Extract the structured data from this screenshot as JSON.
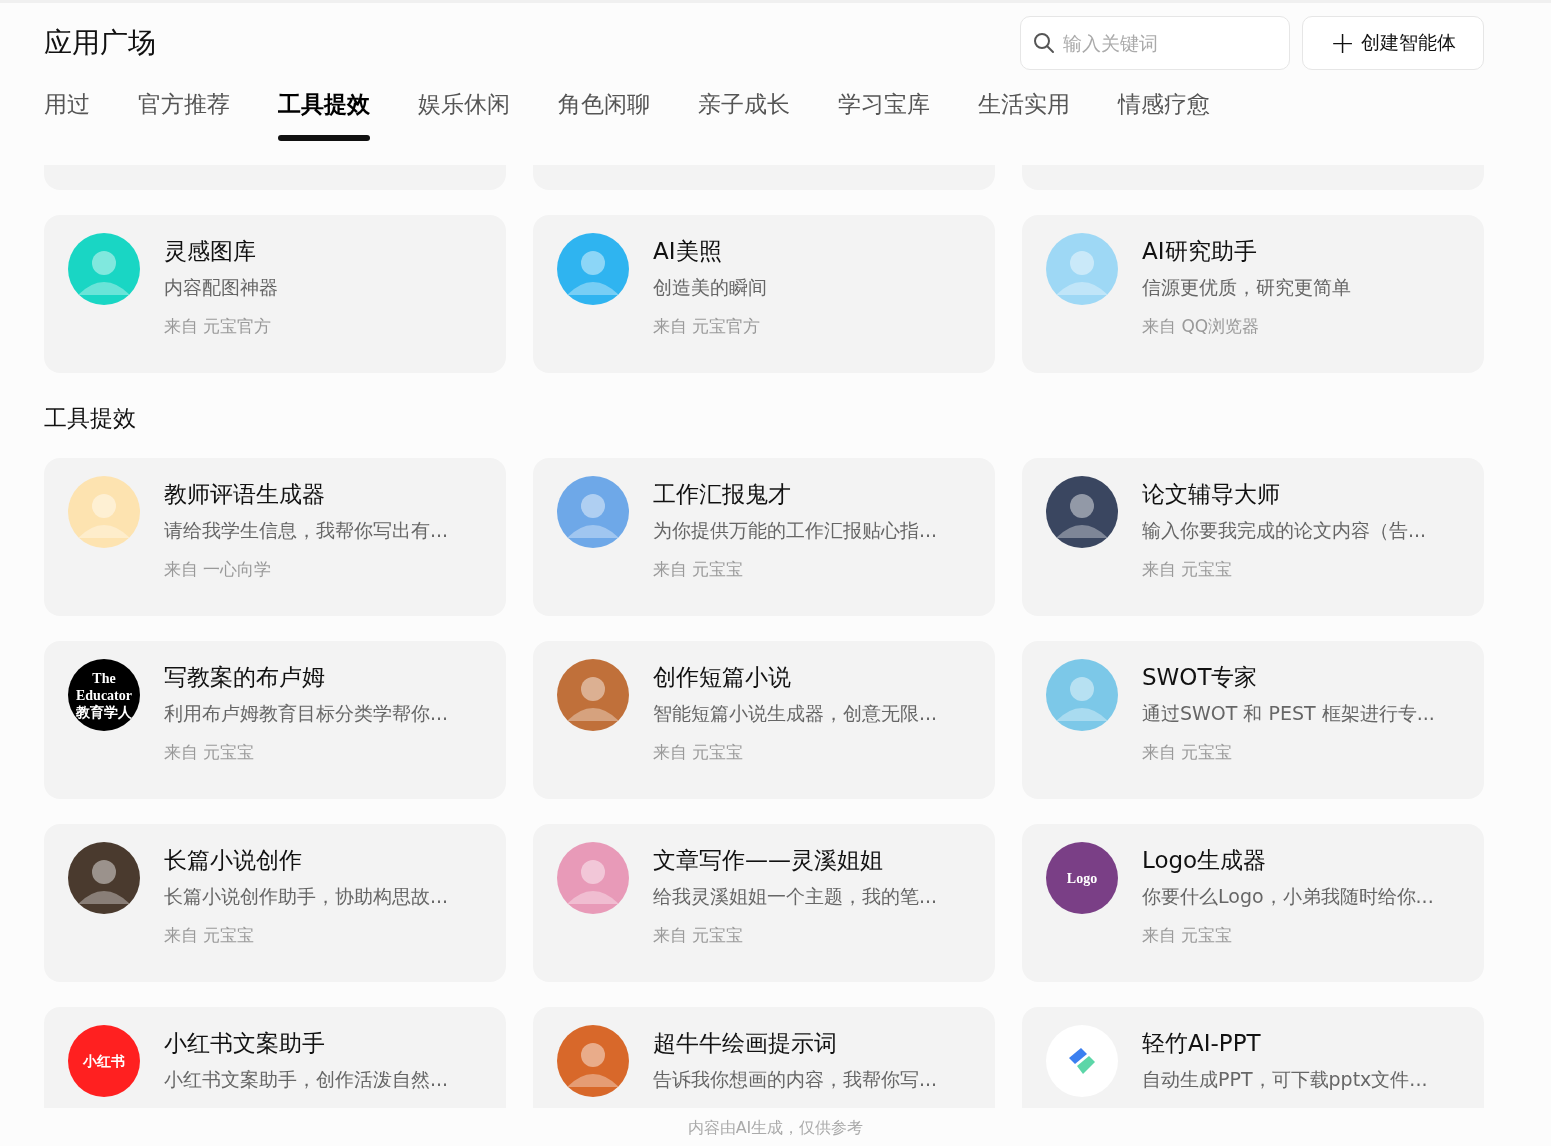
{
  "header": {
    "title": "应用广场",
    "search": {
      "placeholder": "输入关键词"
    },
    "create_button": {
      "label": "创建智能体",
      "icon": "+"
    }
  },
  "tabs": [
    {
      "label": "用过",
      "selected": false
    },
    {
      "label": "官方推荐",
      "selected": false
    },
    {
      "label": "工具提效",
      "selected": true
    },
    {
      "label": "娱乐休闲",
      "selected": false
    },
    {
      "label": "角色闲聊",
      "selected": false
    },
    {
      "label": "亲子成长",
      "selected": false
    },
    {
      "label": "学习宝库",
      "selected": false
    },
    {
      "label": "生活实用",
      "selected": false
    },
    {
      "label": "情感疗愈",
      "selected": false
    }
  ],
  "sections": [
    {
      "cards": [
        {
          "title": "灵感图库",
          "description": "内容配图神器",
          "source": "来自 元宝官方",
          "avatar": {
            "kind": "picture",
            "color": "#19d6c4"
          }
        },
        {
          "title": "AI美照",
          "description": "创造美的瞬间",
          "source": "来自 元宝官方",
          "avatar": {
            "kind": "picture",
            "color": "#2fb4f0"
          }
        },
        {
          "title": "AI研究助手",
          "description": "信源更优质，研究更简单",
          "source": "来自 QQ浏览器",
          "avatar": {
            "kind": "picture",
            "color": "#9ed8f5"
          }
        }
      ]
    },
    {
      "title": "工具提效",
      "cards": [
        {
          "title": "教师评语生成器",
          "description": "请给我学生信息，我帮你写出有...",
          "source": "来自 一心向学",
          "avatar": {
            "kind": "picture",
            "color": "#fde3b0"
          }
        },
        {
          "title": "工作汇报鬼才",
          "description": "为你提供万能的工作汇报贴心指...",
          "source": "来自 元宝宝",
          "avatar": {
            "kind": "picture",
            "color": "#6ea8e8"
          }
        },
        {
          "title": "论文辅导大师",
          "description": "输入你要我完成的论文内容（告...",
          "source": "来自 元宝宝",
          "avatar": {
            "kind": "picture",
            "color": "#3a4660"
          }
        },
        {
          "title": "写教案的布卢姆",
          "description": "利用布卢姆教育目标分类学帮你...",
          "source": "来自 元宝宝",
          "avatar": {
            "kind": "logo",
            "color": "#000000",
            "lines": [
              "The",
              "Educator",
              "教育学人"
            ]
          }
        },
        {
          "title": "创作短篇小说",
          "description": "智能短篇小说生成器，创意无限...",
          "source": "来自 元宝宝",
          "avatar": {
            "kind": "picture",
            "color": "#c0703a"
          }
        },
        {
          "title": "SWOT专家",
          "description": "通过SWOT 和 PEST 框架进行专...",
          "source": "来自 元宝宝",
          "avatar": {
            "kind": "picture",
            "color": "#7cc8e8"
          }
        },
        {
          "title": "长篇小说创作",
          "description": "长篇小说创作助手，协助构思故...",
          "source": "来自 元宝宝",
          "avatar": {
            "kind": "picture",
            "color": "#4a3a2e"
          }
        },
        {
          "title": "文章写作——灵溪姐姐",
          "description": "给我灵溪姐姐一个主题，我的笔...",
          "source": "来自 元宝宝",
          "avatar": {
            "kind": "picture",
            "color": "#e89ab8"
          }
        },
        {
          "title": "Logo生成器",
          "description": "你要什么Logo，小弟我随时给你...",
          "source": "来自 元宝宝",
          "avatar": {
            "kind": "logo",
            "color": "#7a3f86",
            "lines": [
              "Logo"
            ]
          }
        },
        {
          "title": "小红书文案助手",
          "description": "小红书文案助手，创作活泼自然...",
          "avatar": {
            "kind": "logo",
            "color": "#ff2020",
            "lines": [
              "小红书"
            ]
          }
        },
        {
          "title": "超牛牛绘画提示词",
          "description": "告诉我你想画的内容，我帮你写...",
          "avatar": {
            "kind": "picture",
            "color": "#d8682a"
          }
        },
        {
          "title": "轻竹AI-PPT",
          "description": "自动生成PPT，可下载pptx文件...",
          "avatar": {
            "kind": "mark",
            "color": "#ffffff"
          }
        }
      ]
    }
  ],
  "footer": "内容由AI生成，仅供参考"
}
